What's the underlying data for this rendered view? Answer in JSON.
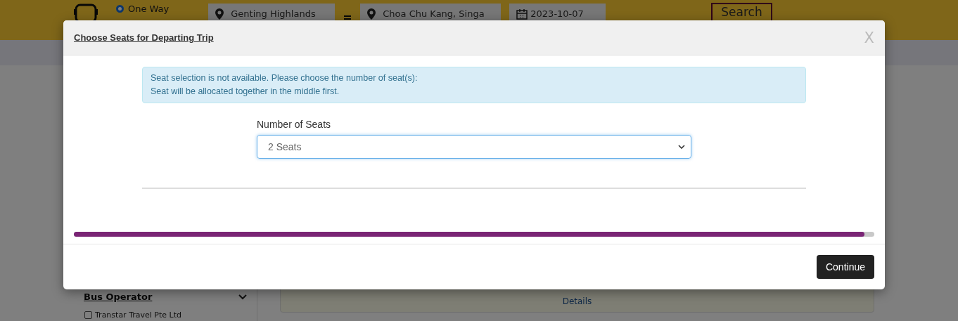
{
  "header": {
    "trip_types": [
      {
        "label": "One Way",
        "selected": true
      }
    ],
    "from": "Genting Highlands",
    "to": "Choa Chu Kang, Singa",
    "date": "2023-10-07",
    "search_button": "Search"
  },
  "sidebar": {
    "filter_title": "Bus Operator",
    "options": [
      {
        "label": "Transtar Travel Pte Ltd",
        "checked": false
      }
    ]
  },
  "result": {
    "details_link": "Details"
  },
  "modal": {
    "title": "Choose Seats for Departing Trip",
    "close": "X",
    "alert_lines": [
      "Seat selection is not available. Please choose the number of seat(s):",
      "Seat will be allocated together in the middle first."
    ],
    "seats_label": "Number of Seats",
    "seats_value": "2 Seats",
    "progress": {
      "level": 0.988
    },
    "continue_button": "Continue"
  }
}
